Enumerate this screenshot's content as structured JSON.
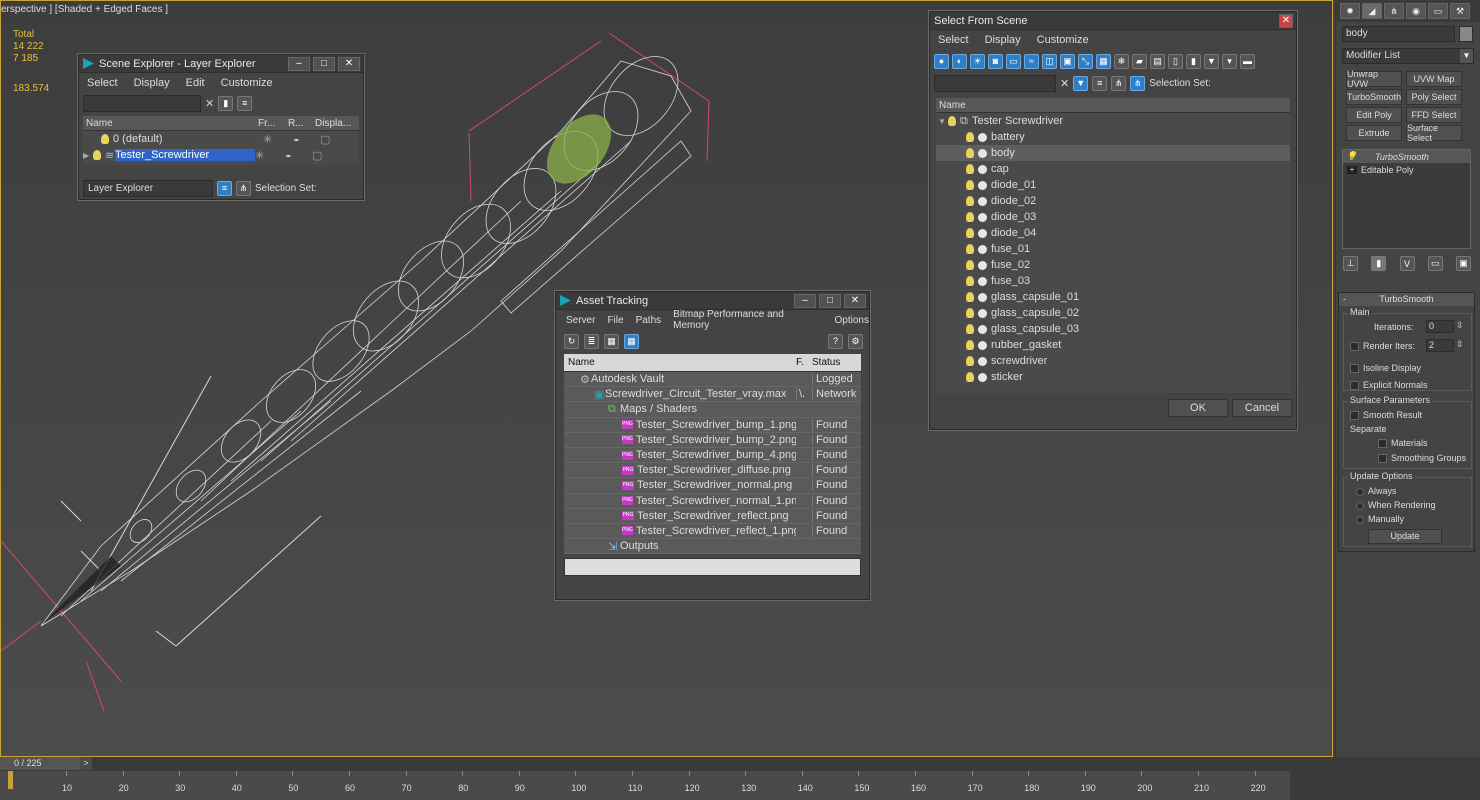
{
  "viewport": {
    "label": "erspective ] [Shaded + Edged Faces ]",
    "stats": {
      "total_label": "Total",
      "polys": "14 222",
      "verts": "7 185",
      "fps": "183.574"
    }
  },
  "scene_explorer": {
    "title": "Scene Explorer - Layer Explorer",
    "menu": [
      "Select",
      "Display",
      "Edit",
      "Customize"
    ],
    "columns": [
      "Name",
      "Fr...",
      "R...",
      "Displa..."
    ],
    "rows": [
      {
        "label": "0 (default)"
      },
      {
        "label": "Tester_Screwdriver"
      }
    ],
    "footer_dropdown": "Layer Explorer",
    "footer_selection": "Selection Set:"
  },
  "select_from_scene": {
    "title": "Select From Scene",
    "menu": [
      "Select",
      "Display",
      "Customize"
    ],
    "selection_set_label": "Selection Set:",
    "column_name": "Name",
    "root": "Tester Screwdriver",
    "items": [
      "battery",
      "body",
      "cap",
      "diode_01",
      "diode_02",
      "diode_03",
      "diode_04",
      "fuse_01",
      "fuse_02",
      "fuse_03",
      "glass_capsule_01",
      "glass_capsule_02",
      "glass_capsule_03",
      "rubber_gasket",
      "screwdriver",
      "sticker"
    ],
    "selected_item": "body",
    "ok_label": "OK",
    "cancel_label": "Cancel"
  },
  "asset_tracking": {
    "title": "Asset Tracking",
    "menu": [
      "Server",
      "File",
      "Paths",
      "Bitmap Performance and Memory",
      "Options"
    ],
    "columns": [
      "Name",
      "F.",
      "Status"
    ],
    "rows": [
      {
        "name": "Autodesk Vault",
        "f": "",
        "status": "Logged"
      },
      {
        "name": "Screwdriver_Circuit_Tester_vray.max",
        "f": "\\.",
        "status": "Network"
      },
      {
        "name": "Maps / Shaders",
        "f": "",
        "status": ""
      },
      {
        "name": "Tester_Screwdriver_bump_1.png",
        "f": "",
        "status": "Found"
      },
      {
        "name": "Tester_Screwdriver_bump_2.png",
        "f": "",
        "status": "Found"
      },
      {
        "name": "Tester_Screwdriver_bump_4.png",
        "f": "",
        "status": "Found"
      },
      {
        "name": "Tester_Screwdriver_diffuse.png",
        "f": "",
        "status": "Found"
      },
      {
        "name": "Tester_Screwdriver_normal.png",
        "f": "",
        "status": "Found"
      },
      {
        "name": "Tester_Screwdriver_normal_1.png",
        "f": "",
        "status": "Found"
      },
      {
        "name": "Tester_Screwdriver_reflect.png",
        "f": "",
        "status": "Found"
      },
      {
        "name": "Tester_Screwdriver_reflect_1.png",
        "f": "",
        "status": "Found"
      },
      {
        "name": "Outputs",
        "f": "",
        "status": ""
      }
    ],
    "png_badge": "PNG"
  },
  "command_panel": {
    "object_name": "body",
    "modifier_list": "Modifier List",
    "buttons": [
      "Unwrap UVW",
      "UVW Map",
      "TurboSmooth",
      "Poly Select",
      "Edit Poly",
      "FFD Select",
      "Extrude",
      "Surface Select"
    ],
    "stack": [
      "TurboSmooth",
      "Editable Poly"
    ],
    "rollout_title": "TurboSmooth",
    "main_label": "Main",
    "iterations_label": "Iterations:",
    "iterations_value": "0",
    "render_iters_label": "Render Iters:",
    "render_iters_value": "2",
    "isoline_label": "Isoline Display",
    "explicit_normals_label": "Explicit Normals",
    "surface_params_label": "Surface Parameters",
    "smooth_result_label": "Smooth Result",
    "separate_label": "Separate",
    "materials_label": "Materials",
    "smoothing_groups_label": "Smoothing Groups",
    "update_options_label": "Update Options",
    "always_label": "Always",
    "when_rendering_label": "When Rendering",
    "manually_label": "Manually",
    "update_button": "Update"
  },
  "timeline": {
    "frame_label": "0 / 225",
    "ticks": [
      "10",
      "20",
      "30",
      "40",
      "50",
      "60",
      "70",
      "80",
      "90",
      "100",
      "110",
      "120",
      "130",
      "140",
      "150",
      "160",
      "170",
      "180",
      "190",
      "200",
      "210",
      "220"
    ]
  }
}
